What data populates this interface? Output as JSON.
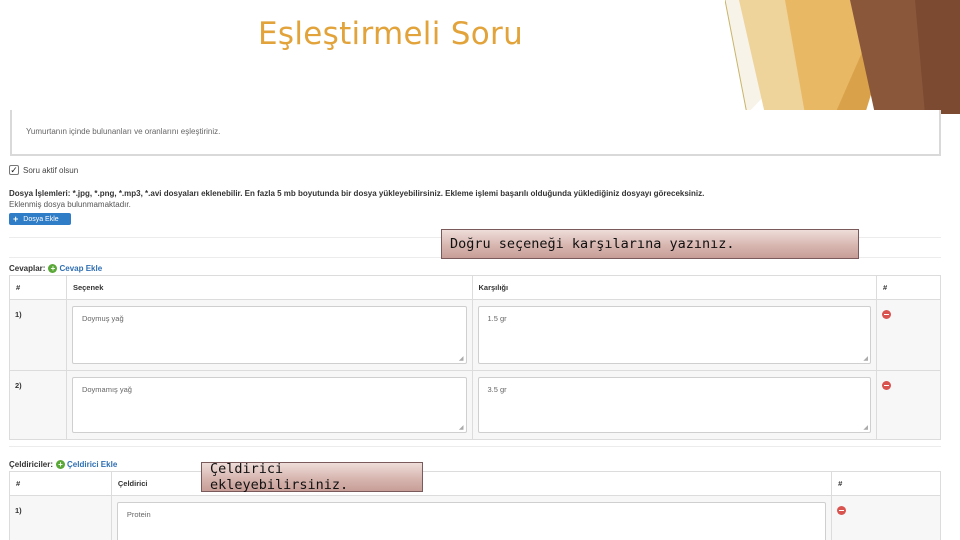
{
  "slide": {
    "title": "Eşleştirmeli Soru"
  },
  "question": {
    "text": "Yumurtanın içinde bulunanları ve oranlarını eşleştiriniz."
  },
  "active": {
    "label": "Soru aktif olsun",
    "checked": true
  },
  "file": {
    "title": "Dosya İşlemleri:",
    "info": " *.jpg, *.png, *.mp3, *.avi dosyaları eklenebilir. En fazla 5 mb boyutunda bir dosya yükleyebilirsiniz. Ekleme işlemi başarılı olduğunda yüklediğiniz dosyayı göreceksiniz.",
    "none": "Eklenmiş dosya bulunmamaktadır.",
    "button_label": "Dosya Ekle"
  },
  "answers": {
    "title": "Cevaplar:",
    "add_label": "Cevap Ekle",
    "headers": [
      "#",
      "Seçenek",
      "Karşılığı",
      "#"
    ],
    "rows": [
      {
        "num": "1)",
        "option": "Doymuş yağ",
        "match": "1.5 gr"
      },
      {
        "num": "2)",
        "option": "Doymamış yağ",
        "match": "3.5 gr"
      }
    ]
  },
  "distractors": {
    "title": "Çeldiriciler:",
    "add_label": "Çeldirici Ekle",
    "headers": [
      "#",
      "Çeldirici",
      "#"
    ],
    "rows": [
      {
        "num": "1)",
        "value": "Protein"
      }
    ]
  },
  "callouts": {
    "answers_note": "Doğru seçeneği karşılarına yazınız.",
    "distractor_note": "Çeldirici ekleyebilirsiniz."
  },
  "colors": {
    "title": "#e2a33b",
    "button": "#2f7cc7",
    "add_icon": "#5aa838",
    "delete_icon": "#d9534f"
  },
  "icons": {
    "checkbox": "checkmark-icon",
    "file_button": "plus-icon",
    "add": "plus-circle-icon",
    "delete": "minus-circle-icon",
    "resize": "resize-grip-icon"
  }
}
